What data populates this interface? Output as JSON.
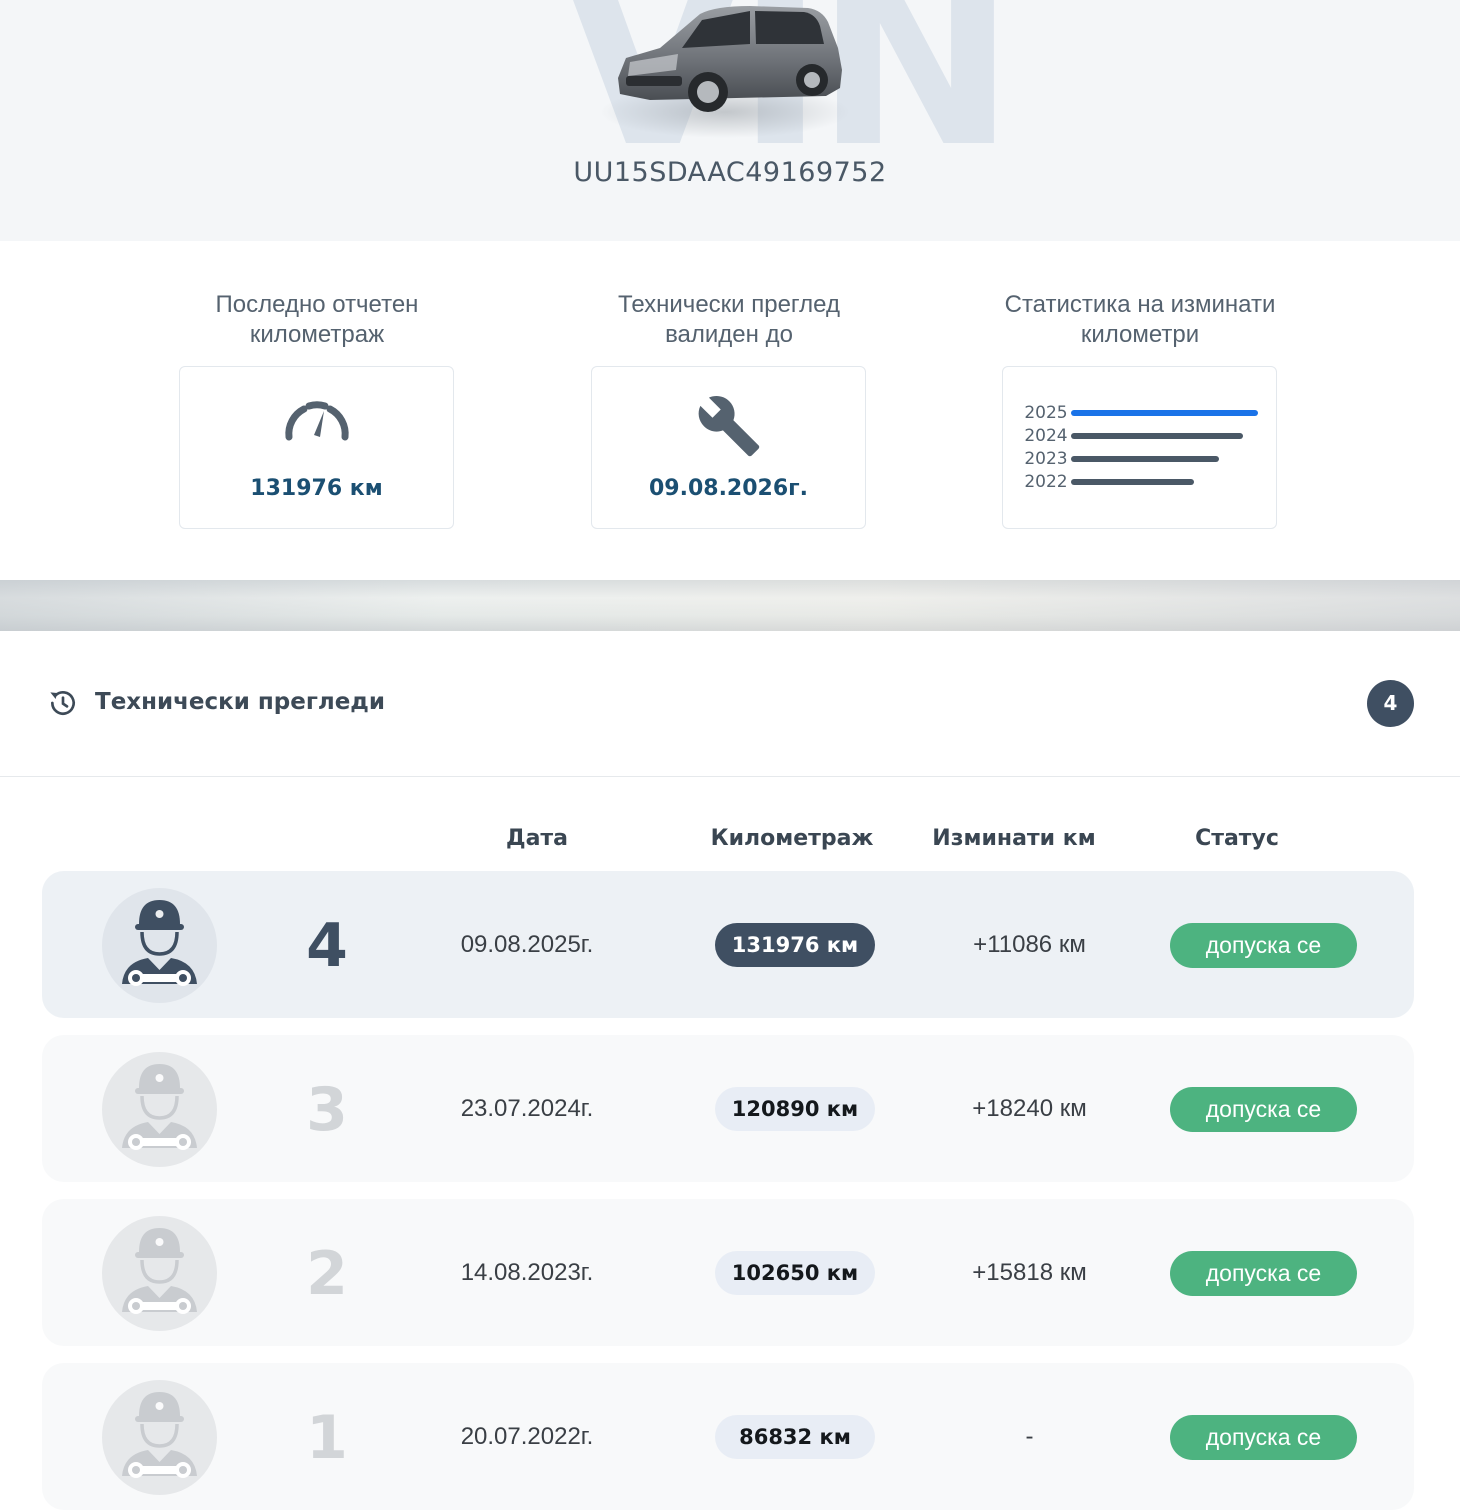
{
  "vehicle": {
    "vin": "UU15SDAAC49169752",
    "watermark": "VIN"
  },
  "stats": {
    "mileage": {
      "title": "Последно отчетен километраж",
      "value": "131976 км",
      "icon": "speedometer-icon"
    },
    "inspection": {
      "title": "Технически преглед валиден до",
      "value": "09.08.2026г.",
      "icon": "wrench-icon"
    },
    "statistics": {
      "title": "Статистика на изминати километри",
      "years": [
        {
          "year": "2025",
          "fraction": 1.0,
          "color": "#1a73e8"
        },
        {
          "year": "2024",
          "fraction": 0.92,
          "color": "#4a5866"
        },
        {
          "year": "2023",
          "fraction": 0.79,
          "color": "#4a5866"
        },
        {
          "year": "2022",
          "fraction": 0.66,
          "color": "#4a5866"
        }
      ]
    }
  },
  "section": {
    "title": "Технически прегледи",
    "count": "4",
    "icon": "history-icon"
  },
  "table": {
    "headers": {
      "date": "Дата",
      "mileage": "Километраж",
      "driven": "Изминати км",
      "status": "Статус"
    },
    "rows": [
      {
        "num": "4",
        "date": "09.08.2025г.",
        "mileage": "131976 км",
        "driven": "+11086 км",
        "status": "допуска се",
        "active": true
      },
      {
        "num": "3",
        "date": "23.07.2024г.",
        "mileage": "120890 км",
        "driven": "+18240 км",
        "status": "допуска се",
        "active": false
      },
      {
        "num": "2",
        "date": "14.08.2023г.",
        "mileage": "102650 км",
        "driven": "+15818 км",
        "status": "допуска се",
        "active": false
      },
      {
        "num": "1",
        "date": "20.07.2022г.",
        "mileage": "86832 км",
        "driven": "-",
        "status": "допуска се",
        "active": false
      }
    ]
  },
  "colors": {
    "accent": "#1b4f72",
    "dark": "#3f4f62",
    "status_ok": "#4db380",
    "chart_highlight": "#1a73e8"
  }
}
